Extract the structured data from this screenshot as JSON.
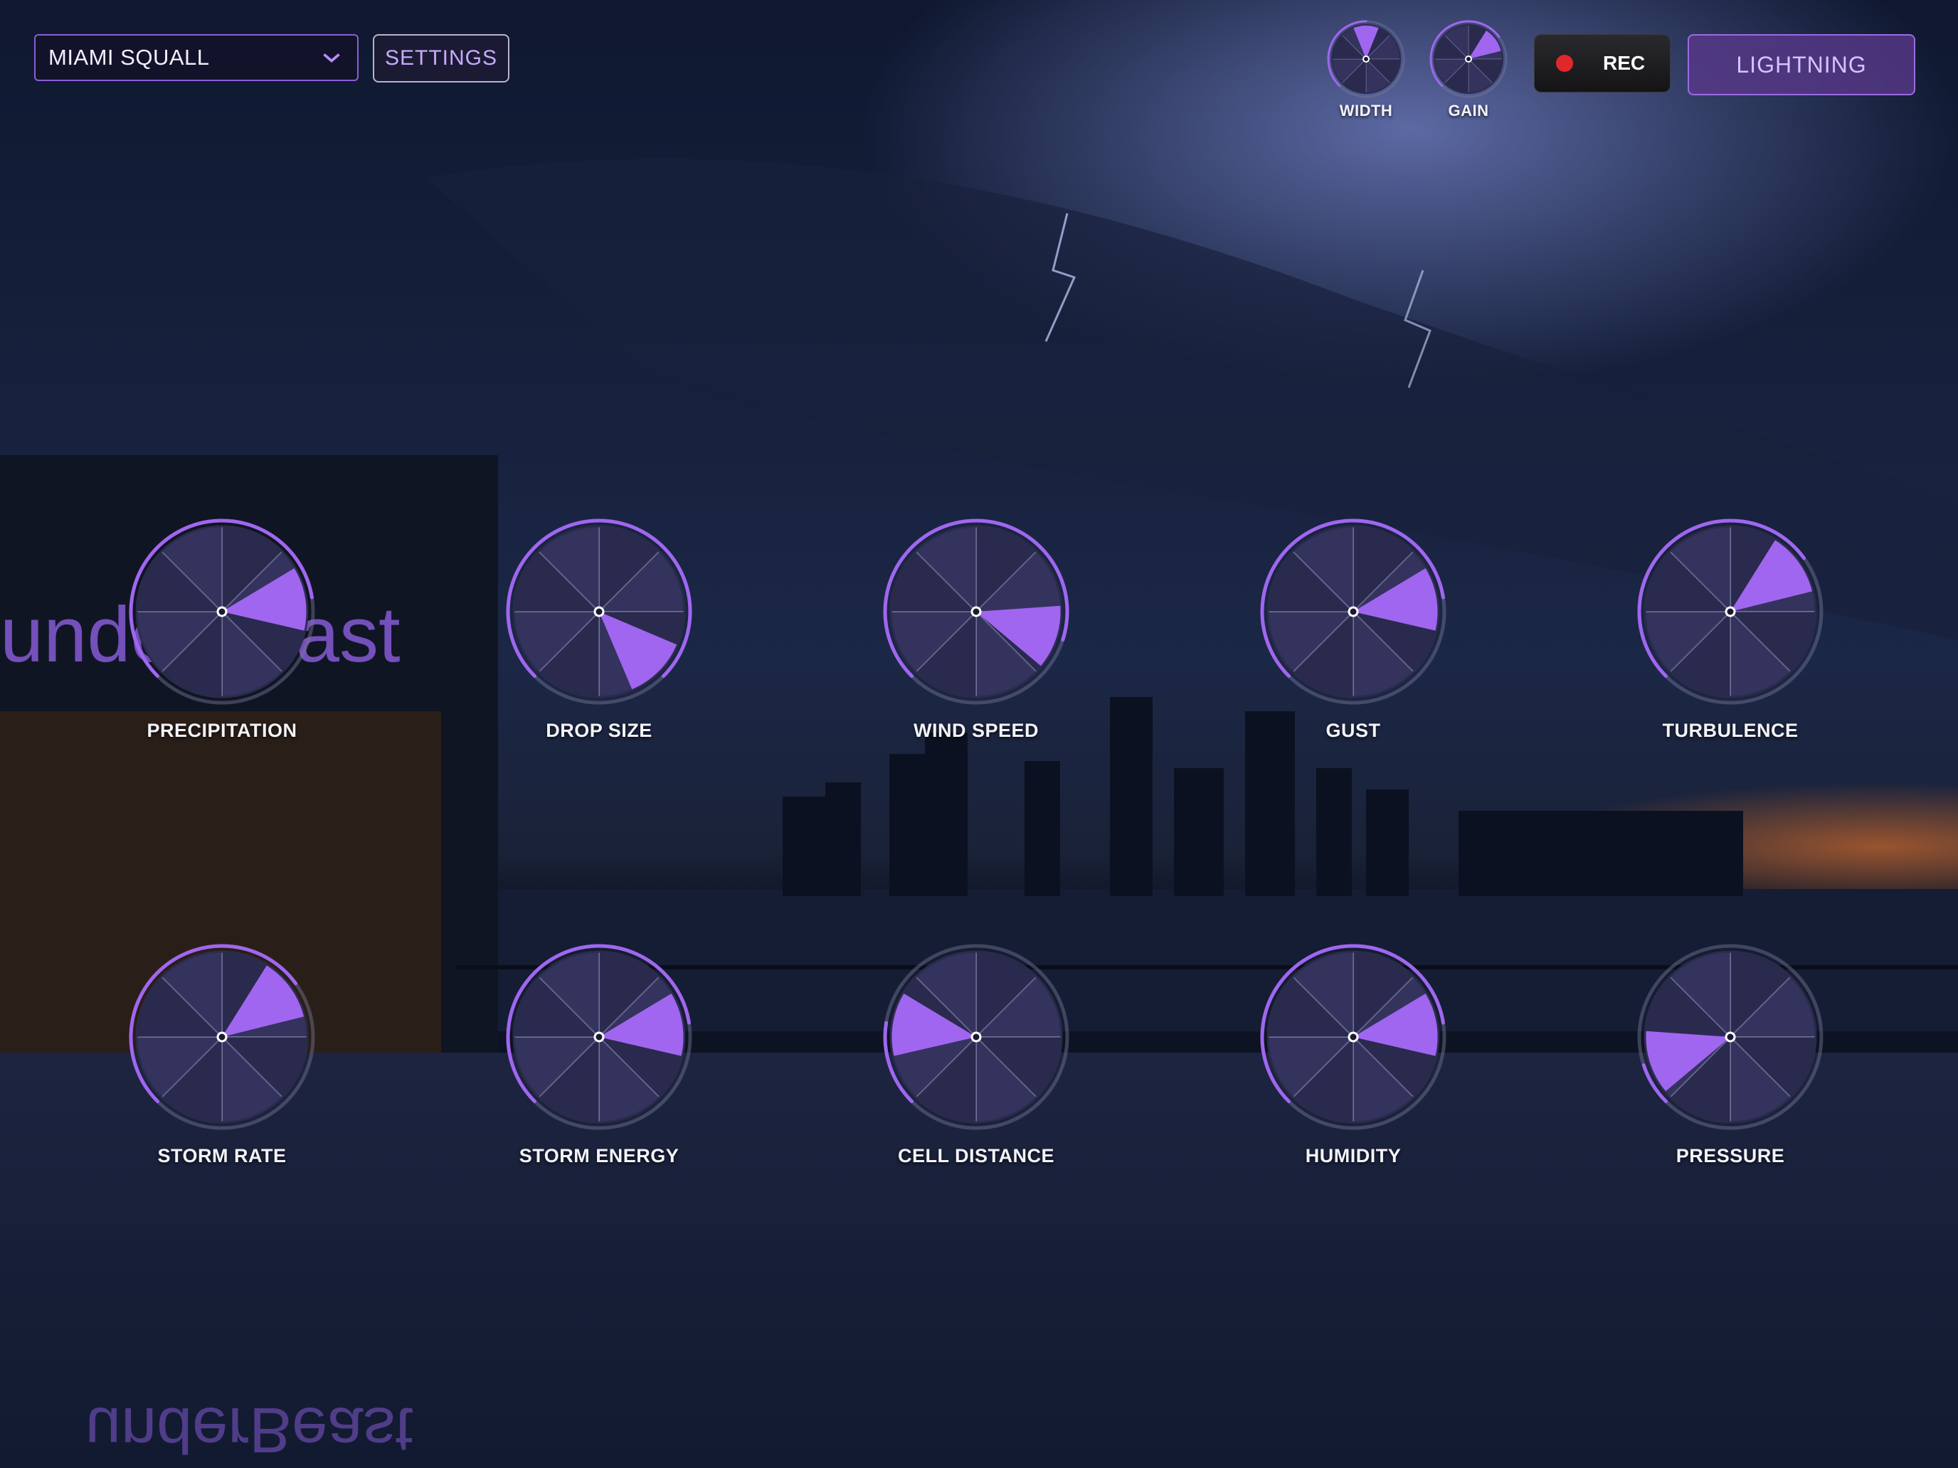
{
  "header": {
    "preset": {
      "value": "MIAMI SQUALL"
    },
    "settings_label": "SETTINGS",
    "rec_label": "REC",
    "lightning_label": "LIGHTNING"
  },
  "background": {
    "sign_text": "underBeast",
    "sign_text_reflection": "underBeast"
  },
  "colors": {
    "accent": "#a066f0",
    "knob_face": "#34335e",
    "knob_face_alt": "#2a2a4e",
    "rec": "#e0282a"
  },
  "mini_knobs": [
    {
      "id": "width",
      "label": "WIDTH",
      "value": 0.5
    },
    {
      "id": "gain",
      "label": "GAIN",
      "value": 0.7
    }
  ],
  "knobs": [
    {
      "id": "precipitation",
      "label": "PRECIPITATION",
      "value": 0.8
    },
    {
      "id": "drop-size",
      "label": "DROP SIZE",
      "value": 1.0
    },
    {
      "id": "wind-speed",
      "label": "WIND SPEED",
      "value": 0.9
    },
    {
      "id": "gust",
      "label": "GUST",
      "value": 0.8
    },
    {
      "id": "turbulence",
      "label": "TURBULENCE",
      "value": 0.7
    },
    {
      "id": "storm-rate",
      "label": "STORM RATE",
      "value": 0.7
    },
    {
      "id": "storm-energy",
      "label": "STORM ENERGY",
      "value": 0.8
    },
    {
      "id": "cell-distance",
      "label": "CELL DISTANCE",
      "value": 0.2
    },
    {
      "id": "humidity",
      "label": "HUMIDITY",
      "value": 0.8
    },
    {
      "id": "pressure",
      "label": "PRESSURE",
      "value": 0.1
    }
  ]
}
